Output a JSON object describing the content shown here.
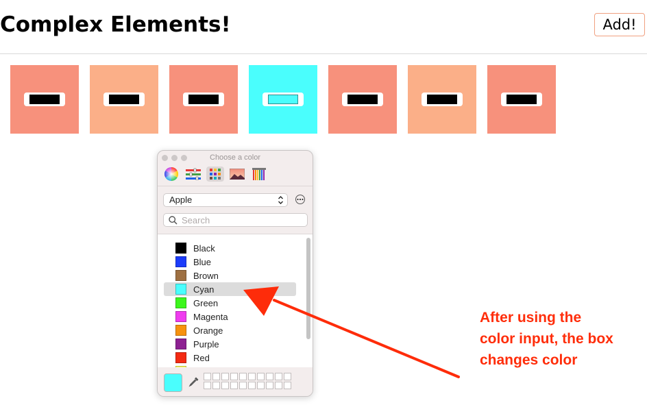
{
  "header": {
    "title": "Complex Elements!",
    "add_label": "Add!"
  },
  "boxes": [
    {
      "color": "#f7917c",
      "input_color": "#000000"
    },
    {
      "color": "#fbaf88",
      "input_color": "#000000"
    },
    {
      "color": "#f7917c",
      "input_color": "#000000"
    },
    {
      "color": "#4afefd",
      "input_color": "#4afefd"
    },
    {
      "color": "#f7917c",
      "input_color": "#000000"
    },
    {
      "color": "#fbaf88",
      "input_color": "#000000"
    },
    {
      "color": "#f7917c",
      "input_color": "#000000"
    }
  ],
  "picker": {
    "title": "Choose a color",
    "modes": [
      "color-wheel-icon",
      "sliders-icon",
      "palettes-icon",
      "image-palettes-icon",
      "pencils-icon"
    ],
    "active_mode": "palettes-icon",
    "palette": "Apple",
    "search_placeholder": "Search",
    "colors": [
      {
        "name": "Black",
        "hex": "#000000"
      },
      {
        "name": "Blue",
        "hex": "#1c3cfb"
      },
      {
        "name": "Brown",
        "hex": "#9e7042"
      },
      {
        "name": "Cyan",
        "hex": "#4afefd",
        "selected": true
      },
      {
        "name": "Green",
        "hex": "#3cf71c"
      },
      {
        "name": "Magenta",
        "hex": "#ef3cef"
      },
      {
        "name": "Orange",
        "hex": "#f7920e"
      },
      {
        "name": "Purple",
        "hex": "#8d2192"
      },
      {
        "name": "Red",
        "hex": "#f42a12"
      },
      {
        "name": "",
        "hex": "#fdfb5c"
      }
    ],
    "current_color": "#4afefd"
  },
  "annotation": {
    "lines": [
      "After using the",
      "color input, the box",
      "changes color"
    ],
    "color": "#ff2d0a"
  }
}
